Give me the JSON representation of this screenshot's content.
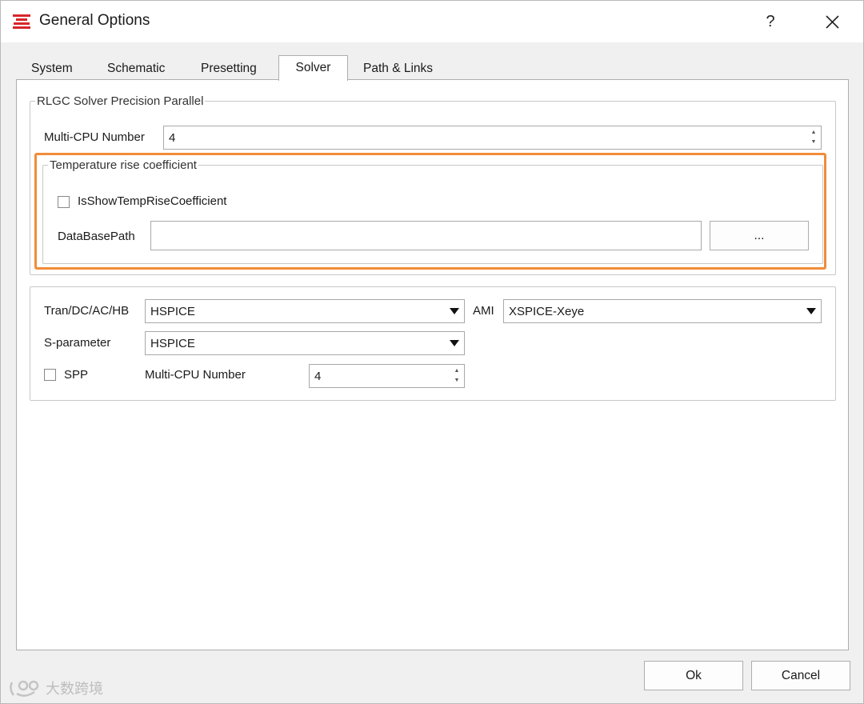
{
  "window": {
    "title": "General Options",
    "help_label": "?",
    "accent_color": "#d6262b",
    "highlight_color": "#f28c38"
  },
  "tabs": [
    {
      "label": "System",
      "active": false
    },
    {
      "label": "Schematic",
      "active": false
    },
    {
      "label": "Presetting",
      "active": false
    },
    {
      "label": "Solver",
      "active": true
    },
    {
      "label": "Path & Links",
      "active": false
    }
  ],
  "rlgc": {
    "legend": "RLGC Solver Precision Parallel",
    "cpu_label": "Multi-CPU Number",
    "cpu_value": "4",
    "temp": {
      "legend": "Temperature rise coefficient",
      "checkbox_label": "IsShowTempRiseCoefficient",
      "checked": false,
      "db_label": "DataBasePath",
      "db_value": "",
      "browse_label": "..."
    }
  },
  "simulators": {
    "tran_label": "Tran/DC/AC/HB",
    "tran_value": "HSPICE",
    "ami_label": "AMI",
    "ami_value": "XSPICE-Xeye",
    "sparam_label": "S-parameter",
    "sparam_value": "HSPICE",
    "spp_label": "SPP",
    "spp_checked": false,
    "cpu_label": "Multi-CPU Number",
    "cpu_value": "4"
  },
  "footer": {
    "ok_label": "Ok",
    "cancel_label": "Cancel"
  },
  "watermark": {
    "text": "大数跨境"
  }
}
